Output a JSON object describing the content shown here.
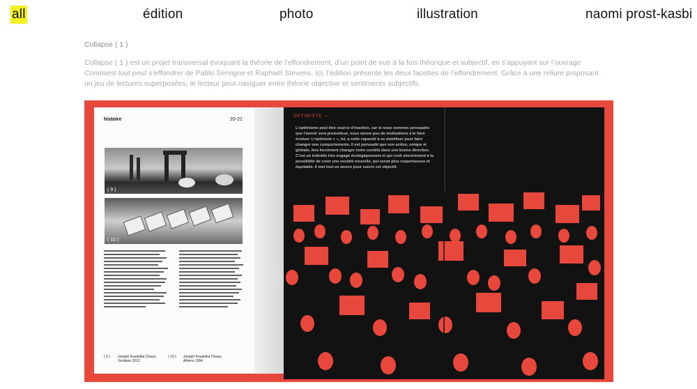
{
  "nav": {
    "items": [
      {
        "label": "all",
        "active": true
      },
      {
        "label": "édition"
      },
      {
        "label": "photo"
      },
      {
        "label": "illustration"
      },
      {
        "label": "naomi prost-kasbi"
      }
    ]
  },
  "project": {
    "title": "Collapse ( 1 )",
    "desc_part1": "Collapse ( 1 ) est un projet transversal évoquant la théorie de l’effondrement, d’un point de vue à la fois théorique et subjectif, en s’appuyant sur l’ouvrage ",
    "desc_book": "Comment tout peut s’effondrer",
    "desc_part2": " de Pablo Servigne et Raphaël Stevens. Ici, l’édition présente les deux facettes de l’effondrement. Grâce à une reliure proposant un jeu de lectures superposées, le lecteur peut naviguer entre théorie objective et sentiments subjectifs."
  },
  "book": {
    "left_header": "histoire",
    "left_page_num": "20-21",
    "img1_caption": "( 9 )",
    "img2_caption": "( 10 )",
    "cap1_num": "( 9 )",
    "cap1_text": "Joseph Koudelka Chaos, Jordanie 2012",
    "cap2_num": "( 10 )",
    "cap2_text": "Joseph Koudelka Chaos, Athens 1994",
    "right_label": "OPTIMISTE —",
    "right_text": "L’optimisme peut être source d’inaction, car si nous sommes persuadés que l’avenir sera prometteur, nous avons peu de motivations à le faire évoluer. L’optimiste « », lui, a cette capacité à se mobiliser pour faire changer nos comportements. Il est persuadé que son action, unique et globale, fera forcément changer notre société dans une bonne direction. C’est un individu très engagé écologiquement et qui croit sincèrement à la possibilité de créer une société nouvelle, qui serait plus respectueuse et équitable. Il met tout en œuvre pour suivre cet objectif.",
    "accent": "#e8483c"
  }
}
